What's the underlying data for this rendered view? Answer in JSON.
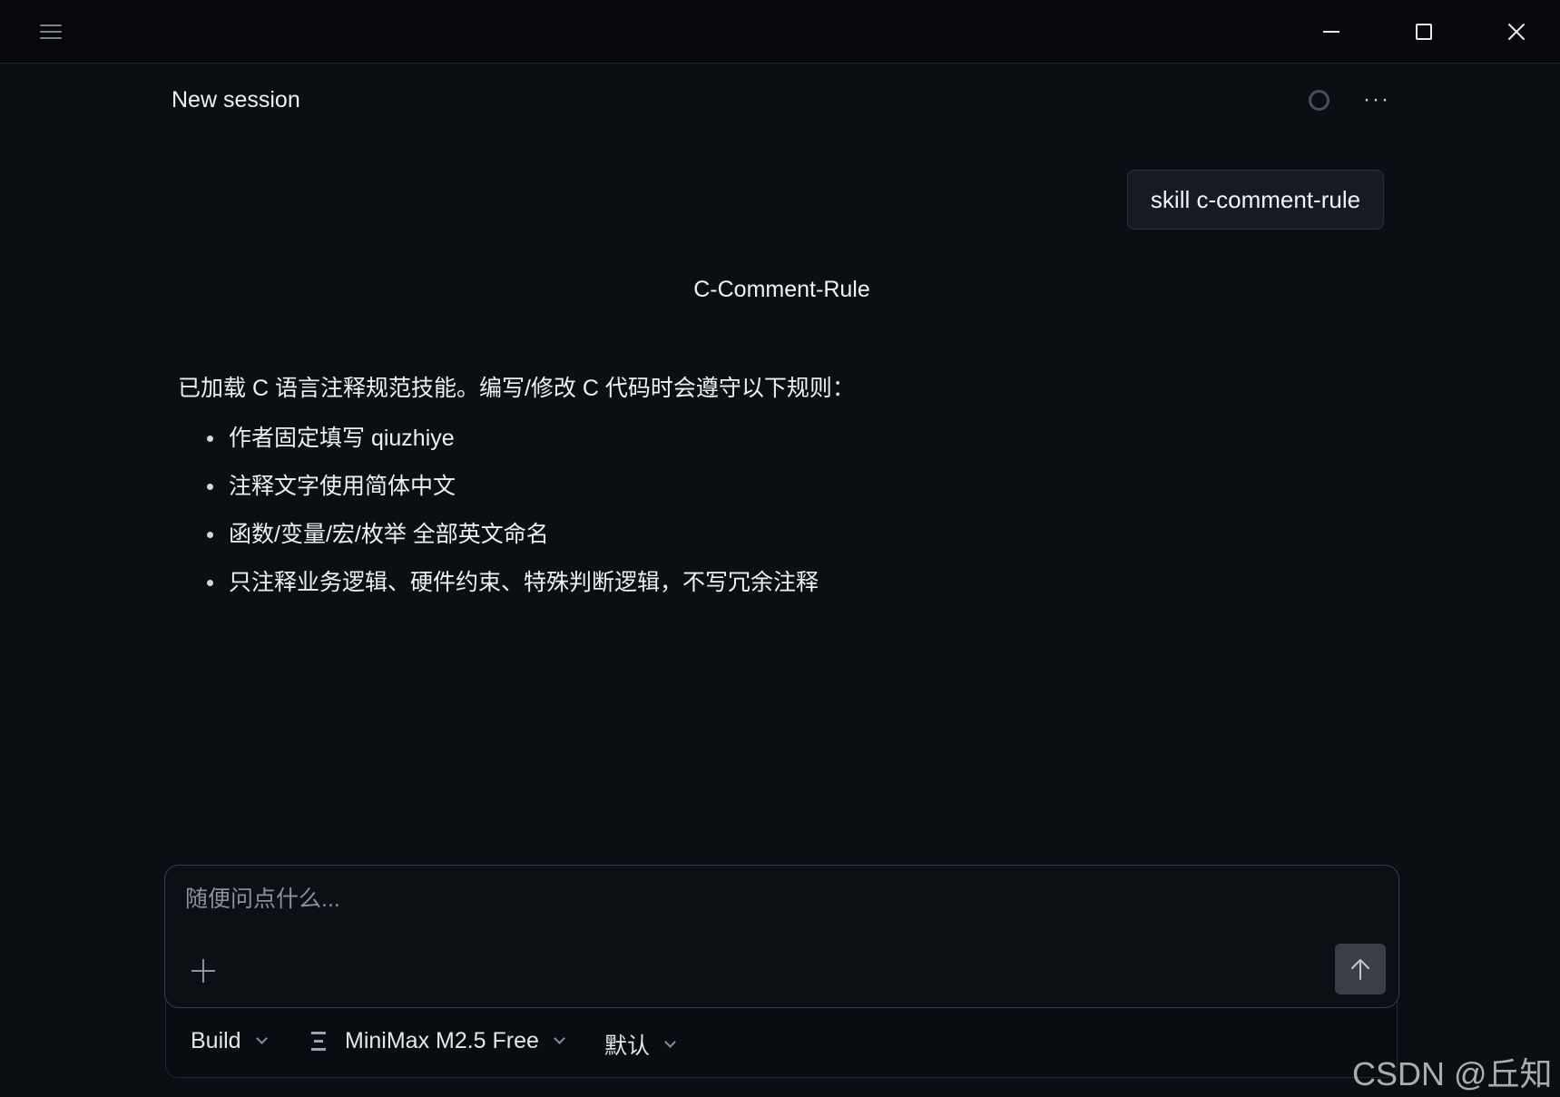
{
  "window": {
    "menu_icon": "hamburger-menu-icon",
    "minimize_icon": "minimize-icon",
    "maximize_icon": "maximize-icon",
    "close_icon": "close-icon"
  },
  "session": {
    "title": "New session",
    "status_icon": "loading-ring-icon",
    "more_label": "···"
  },
  "conversation": {
    "user_message": "skill c-comment-rule",
    "response": {
      "heading": "C-Comment-Rule",
      "intro": "已加载 C 语言注释规范技能。编写/修改 C 代码时会遵守以下规则：",
      "rules": [
        "作者固定填写 qiuzhiye",
        "注释文字使用简体中文",
        "函数/变量/宏/枚举 全部英文命名",
        "只注释业务逻辑、硬件约束、特殊判断逻辑，不写冗余注释"
      ]
    }
  },
  "composer": {
    "placeholder": "随便问点什么...",
    "add_icon": "plus-icon",
    "send_icon": "arrow-up-icon",
    "agent_label": "Build",
    "model_icon": "model-provider-icon",
    "model_label": "MiniMax M2.5 Free",
    "variant_label": "默认"
  },
  "watermark": "CSDN @丘知叶",
  "colors": {
    "background": "#0b0e13",
    "titlebar": "#07090d",
    "user_bubble": "#161a21",
    "send_button": "#3a3e45",
    "text": "#eef0f4"
  }
}
